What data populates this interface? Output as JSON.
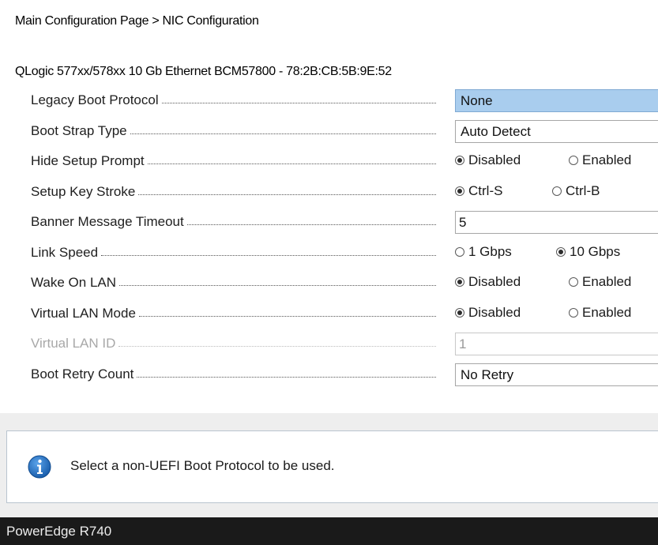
{
  "breadcrumb": "Main Configuration Page > NIC Configuration",
  "device_title": "QLogic 577xx/578xx 10 Gb Ethernet BCM57800 - 78:2B:CB:5B:9E:52",
  "settings": {
    "legacy_boot_protocol": {
      "label": "Legacy Boot Protocol",
      "value": "None"
    },
    "boot_strap_type": {
      "label": "Boot Strap Type",
      "value": "Auto Detect"
    },
    "hide_setup_prompt": {
      "label": "Hide Setup Prompt",
      "options": [
        "Disabled",
        "Enabled"
      ],
      "selected": "Disabled"
    },
    "setup_key_stroke": {
      "label": "Setup Key Stroke",
      "options": [
        "Ctrl-S",
        "Ctrl-B"
      ],
      "selected": "Ctrl-S"
    },
    "banner_message_timeout": {
      "label": "Banner Message Timeout",
      "value": "5"
    },
    "link_speed": {
      "label": "Link Speed",
      "options": [
        "1 Gbps",
        "10 Gbps"
      ],
      "selected": "10 Gbps"
    },
    "wake_on_lan": {
      "label": "Wake On LAN",
      "options": [
        "Disabled",
        "Enabled"
      ],
      "selected": "Disabled"
    },
    "virtual_lan_mode": {
      "label": "Virtual LAN Mode",
      "options": [
        "Disabled",
        "Enabled"
      ],
      "selected": "Disabled"
    },
    "virtual_lan_id": {
      "label": "Virtual LAN ID",
      "value": "1"
    },
    "boot_retry_count": {
      "label": "Boot Retry Count",
      "value": "No Retry"
    }
  },
  "help": {
    "icon": "info-icon",
    "text": "Select a non-UEFI Boot Protocol to be used."
  },
  "footer": {
    "system_name": "PowerEdge R740"
  },
  "colors": {
    "selection": "#a9cdee",
    "footer_bg": "#1a1a1a",
    "info_icon": "#1f6fc4"
  }
}
